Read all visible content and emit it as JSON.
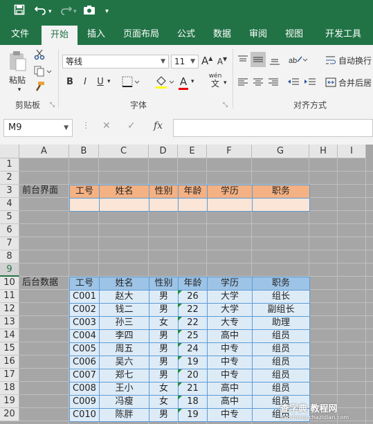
{
  "qat": {
    "icons": [
      "save-icon",
      "undo-icon",
      "redo-icon",
      "camera-icon",
      "customize-icon"
    ]
  },
  "tabs": [
    "文件",
    "开始",
    "插入",
    "页面布局",
    "公式",
    "数据",
    "审阅",
    "视图",
    "开发工具"
  ],
  "active_tab": "开始",
  "ribbon": {
    "paste_label": "粘贴",
    "clipboard_group": "剪贴板",
    "font_name": "等线",
    "font_size": "11",
    "grow_font": "A",
    "shrink_font": "A",
    "bold": "B",
    "italic": "I",
    "underline": "U",
    "font_color_glyph": "A",
    "phonetic_top": "wén",
    "phonetic_bottom": "文",
    "font_group": "字体",
    "wrap_text": "自动换行",
    "merge_center": "合并后居",
    "alignment_group": "对齐方式"
  },
  "formula_bar": {
    "name_box": "M9",
    "fx": "fx",
    "formula": ""
  },
  "colors": {
    "excel_green": "#217346",
    "orange_header": "#f4b183",
    "orange_input": "#fbe5d6",
    "blue_header": "#9dc3e6",
    "blue_data": "#ddebf7",
    "border_blue": "#5b9bd5"
  },
  "sheet": {
    "columns": [
      "A",
      "B",
      "C",
      "D",
      "E",
      "F",
      "G",
      "H",
      "I"
    ],
    "rows": [
      "1",
      "2",
      "3",
      "4",
      "5",
      "6",
      "7",
      "8",
      "9",
      "10",
      "11",
      "12",
      "13",
      "14",
      "15",
      "16",
      "17",
      "18",
      "19",
      "20"
    ],
    "selected_row": "9",
    "front_label": "前台界面",
    "front_headers": [
      "工号",
      "姓名",
      "性别",
      "年龄",
      "学历",
      "职务"
    ],
    "back_label": "后台数据",
    "back_headers": [
      "工号",
      "姓名",
      "性别",
      "年龄",
      "学历",
      "职务"
    ],
    "records": [
      [
        "C001",
        "赵大",
        "男",
        "26",
        "大学",
        "组长"
      ],
      [
        "C002",
        "钱二",
        "男",
        "22",
        "大学",
        "副组长"
      ],
      [
        "C003",
        "孙三",
        "女",
        "22",
        "大专",
        "助理"
      ],
      [
        "C004",
        "李四",
        "男",
        "25",
        "高中",
        "组员"
      ],
      [
        "C005",
        "周五",
        "男",
        "24",
        "中专",
        "组员"
      ],
      [
        "C006",
        "吴六",
        "男",
        "19",
        "中专",
        "组员"
      ],
      [
        "C007",
        "郑七",
        "男",
        "20",
        "中专",
        "组员"
      ],
      [
        "C008",
        "王小",
        "女",
        "21",
        "高中",
        "组员"
      ],
      [
        "C009",
        "冯瘦",
        "女",
        "18",
        "高中",
        "组员"
      ],
      [
        "C010",
        "陈胖",
        "男",
        "19",
        "中专",
        "组员"
      ]
    ]
  },
  "watermark": {
    "line1": "查字典 教程网",
    "line2": "jiaocheng.chazidian.com"
  }
}
